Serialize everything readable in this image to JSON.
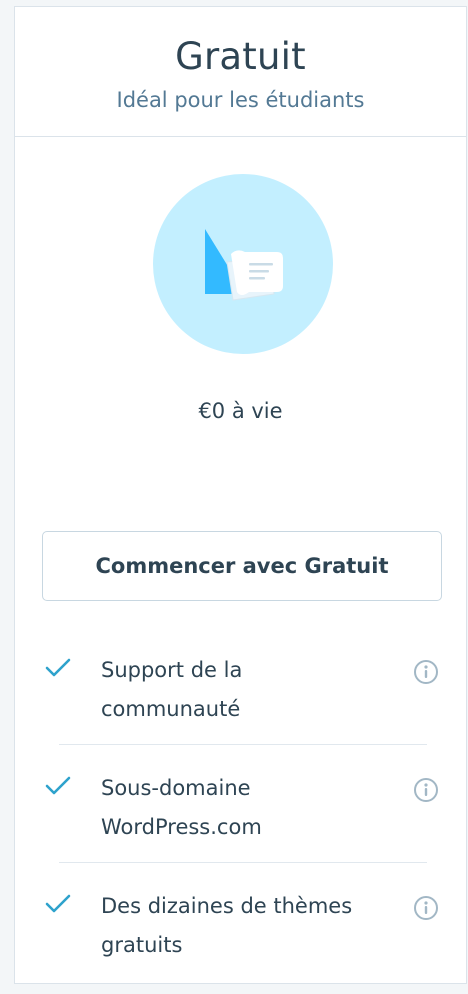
{
  "plan": {
    "title": "Gratuit",
    "tagline": "Idéal pour les étudiants",
    "icon": "free-plan-papers-icon",
    "price": "€0 à vie",
    "cta_label": "Commencer avec Gratuit"
  },
  "features": [
    {
      "line1": "Support de la",
      "line2": "communauté"
    },
    {
      "line1": "Sous-domaine",
      "line2": "WordPress.com"
    },
    {
      "line1": "Des dizaines de thèmes",
      "line2": "gratuits"
    }
  ],
  "colors": {
    "accent": "#2ea2cc",
    "icon_circle": "#c3efff",
    "icon_blue": "#33baff",
    "text": "#2e4453",
    "muted": "#537994",
    "border": "#dbe3ea",
    "info_icon": "#a2b7c5"
  }
}
